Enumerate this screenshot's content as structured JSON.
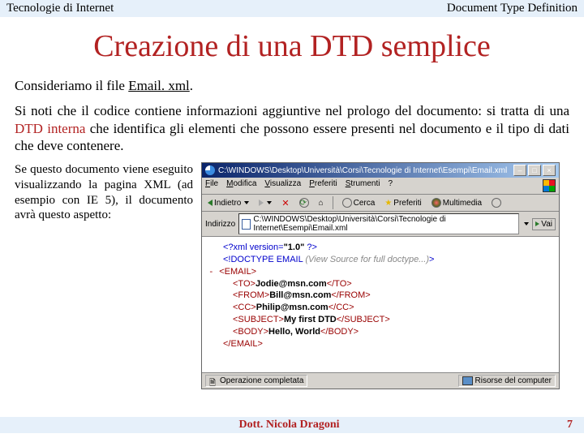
{
  "header": {
    "left": "Tecnologie di Internet",
    "right": "Document Type Definition"
  },
  "title": "Creazione di una DTD semplice",
  "intro_pre": "Consideriamo il file ",
  "intro_link": "Email. xml",
  "intro_post": ".",
  "para2_a": "Si noti che il codice contiene informazioni aggiuntive nel prologo del documento: si tratta di una ",
  "para2_dtd": "DTD interna",
  "para2_b": " che identifica gli elementi che possono essere presenti nel documento e il tipo di dati che deve contenere.",
  "leftcol": "Se questo documento viene eseguito visualizzando la pagina XML (ad esempio con IE 5), il documento avrà questo aspetto:",
  "browser": {
    "title": "C:\\WINDOWS\\Desktop\\Università\\Corsi\\Tecnologie di Internet\\Esempi\\Email.xml",
    "menu": [
      "File",
      "Modifica",
      "Visualizza",
      "Preferiti",
      "Strumenti",
      "?"
    ],
    "back": "Indietro",
    "tool_search": "Cerca",
    "tool_fav": "Preferiti",
    "tool_media": "Multimedia",
    "addr_label": "Indirizzo",
    "addr_value": "C:\\WINDOWS\\Desktop\\Università\\Corsi\\Tecnologie di Internet\\Esempi\\Email.xml",
    "vai": "Vai",
    "xml": {
      "decl_a": "<?xml version=",
      "decl_b": "\"1.0\"",
      "decl_c": " ?>",
      "doctype": "<!DOCTYPE EMAIL ",
      "doctype_note": "(View Source for full doctype...)",
      "doctype_end": ">",
      "minus": "- ",
      "email_open": "<EMAIL>",
      "to_o": "<TO>",
      "to_v": "Jodie@msn.com",
      "to_c": "</TO>",
      "from_o": "<FROM>",
      "from_v": "Bill@msn.com",
      "from_c": "</FROM>",
      "cc_o": "<CC>",
      "cc_v": "Philip@msn.com",
      "cc_c": "</CC>",
      "subj_o": "<SUBJECT>",
      "subj_v": "My first DTD",
      "subj_c": "</SUBJECT>",
      "body_o": "<BODY>",
      "body_v": "Hello, World",
      "body_c": "</BODY>",
      "email_close": "</EMAIL>"
    },
    "status_done": "Operazione completata",
    "status_zone": "Risorse del computer"
  },
  "footer": {
    "author": "Dott. Nicola Dragoni",
    "page": "7"
  }
}
